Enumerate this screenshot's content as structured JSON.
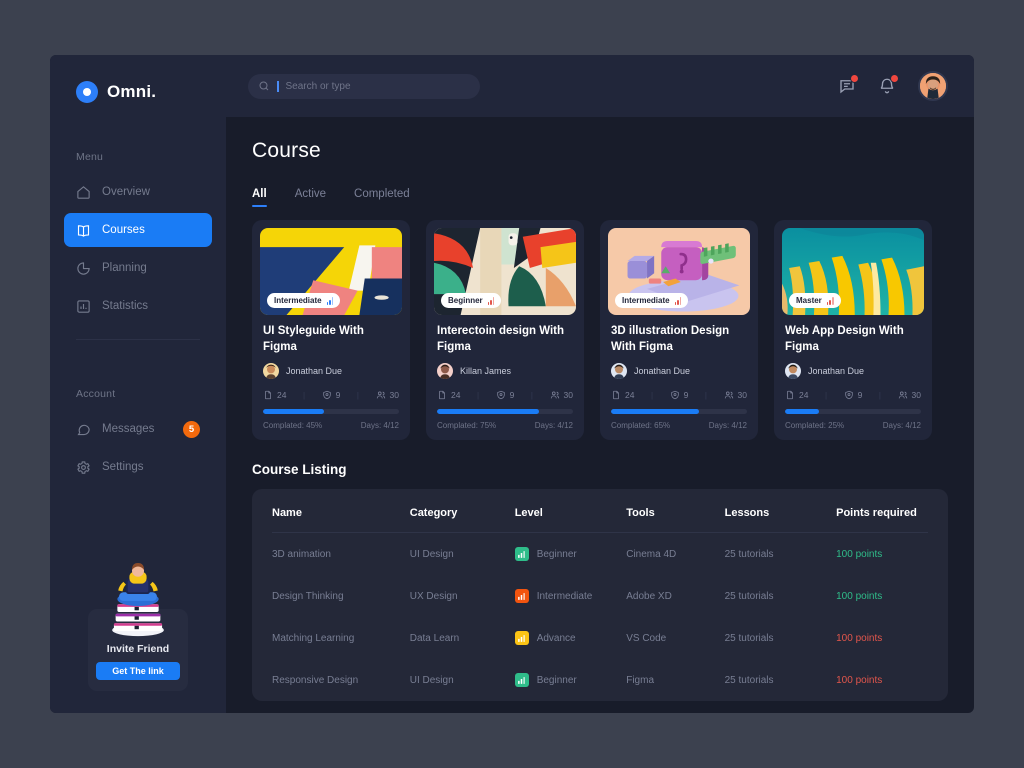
{
  "brand": {
    "name": "Omni.",
    "logo_icon": "omni-circle-logo"
  },
  "sidebar": {
    "menu_label": "Menu",
    "account_label": "Account",
    "menu_items": [
      {
        "label": "Overview",
        "icon": "home-icon",
        "active": false
      },
      {
        "label": "Courses",
        "icon": "book-icon",
        "active": true
      },
      {
        "label": "Planning",
        "icon": "pie-chart-icon",
        "active": false
      },
      {
        "label": "Statistics",
        "icon": "bar-chart-icon",
        "active": false
      }
    ],
    "account_items": [
      {
        "label": "Messages",
        "icon": "chat-bubble-icon",
        "badge": "5"
      },
      {
        "label": "Settings",
        "icon": "gear-icon",
        "badge": ""
      }
    ],
    "invite": {
      "title": "Invite Friend",
      "button": "Get The link",
      "illustration": "person-on-books-illustration"
    }
  },
  "topbar": {
    "search_placeholder": "Search or type",
    "search_value": "",
    "search_icon": "search-icon",
    "message_icon": "message-icon",
    "bell_icon": "bell-icon",
    "avatar": "user-avatar"
  },
  "page": {
    "title": "Course",
    "tabs": [
      {
        "label": "All",
        "active": true
      },
      {
        "label": "Active",
        "active": false
      },
      {
        "label": "Completed",
        "active": false
      }
    ],
    "listing_title": "Course Listing"
  },
  "colors": {
    "accent": "#1a7cf5",
    "badge_orange": "#f2690d",
    "points_green": "#2fbd8a",
    "points_red": "#e2564c",
    "beginner_chip": "#2fbd8a",
    "intermediate_chip": "#f2540f",
    "advance_chip": "#fcc415",
    "sidebar_bg": "#21263a",
    "main_bg": "#181c2a",
    "card_bg": "#242838"
  },
  "courses": [
    {
      "level": "Intermediate",
      "title": "UI Styleguide With Figma",
      "author": "Jonathan Due",
      "files": "24",
      "awards": "9",
      "members": "30",
      "progress": 45,
      "completed_label": "Complated: 45%",
      "days_label": "Days: 4/12",
      "thumb": "abstract-yellow-blue-collage"
    },
    {
      "level": "Beginner",
      "title": "Interectoin design With Figma",
      "author": "Killan James",
      "files": "24",
      "awards": "9",
      "members": "30",
      "progress": 75,
      "completed_label": "Complated: 75%",
      "days_label": "Days: 4/12",
      "thumb": "abstract-red-green-painting"
    },
    {
      "level": "Intermediate",
      "title": "3D illustration Design With Figma",
      "author": "Jonathan Due",
      "files": "24",
      "awards": "9",
      "members": "30",
      "progress": 65,
      "completed_label": "Complated: 65%",
      "days_label": "Days: 4/12",
      "thumb": "3d-purple-box-render"
    },
    {
      "level": "Master",
      "title": "Web App Design With Figma",
      "author": "Jonathan Due",
      "files": "24",
      "awards": "9",
      "members": "30",
      "progress": 25,
      "completed_label": "Complated: 25%",
      "days_label": "Days: 4/12",
      "thumb": "teal-yellow-gradient-art"
    }
  ],
  "table": {
    "columns": [
      "Name",
      "Category",
      "Level",
      "Tools",
      "Lessons",
      "Points required"
    ],
    "rows": [
      {
        "name": "3D animation",
        "category": "UI Design",
        "level": "Beginner",
        "tools": "Cinema 4D",
        "lessons": "25 tutorials",
        "points": "100 points",
        "points_color": "green",
        "chip": "#2fbd8a"
      },
      {
        "name": "Design Thinking",
        "category": "UX Design",
        "level": "Intermediate",
        "tools": "Adobe XD",
        "lessons": "25 tutorials",
        "points": "100 points",
        "points_color": "green",
        "chip": "#f2540f"
      },
      {
        "name": "Matching Learning",
        "category": "Data Learn",
        "level": "Advance",
        "tools": "VS Code",
        "lessons": "25 tutorials",
        "points": "100 points",
        "points_color": "red",
        "chip": "#fcc415"
      },
      {
        "name": "Responsive Design",
        "category": "UI Design",
        "level": "Beginner",
        "tools": "Figma",
        "lessons": "25 tutorials",
        "points": "100 points",
        "points_color": "red",
        "chip": "#2fbd8a"
      }
    ]
  }
}
